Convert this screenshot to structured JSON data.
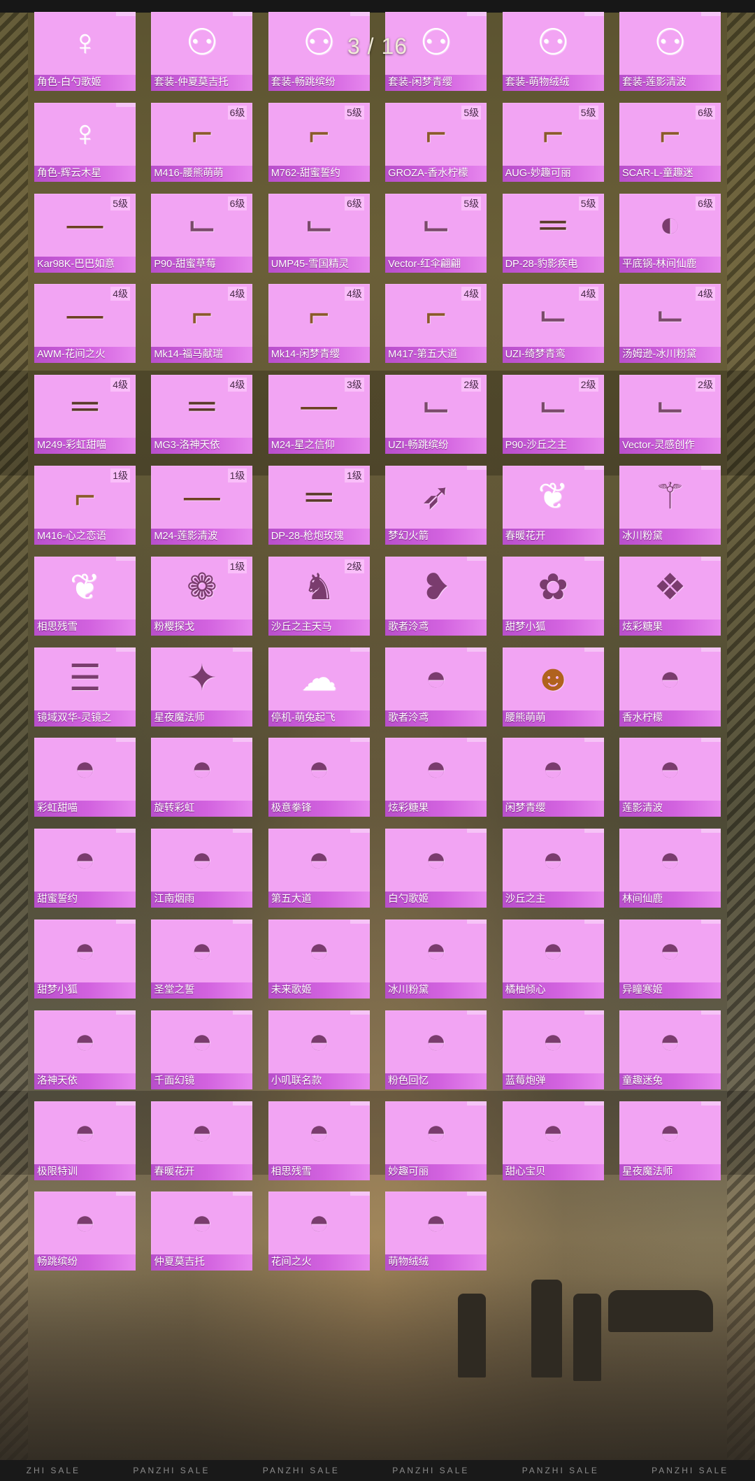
{
  "viewer": {
    "page_counter": "3 / 16"
  },
  "cards": [
    {
      "name": "角色-白勺歌姬",
      "level": "",
      "icon": "character-icon"
    },
    {
      "name": "套装-仲夏莫吉托",
      "level": "",
      "icon": "outfit-icon"
    },
    {
      "name": "套装-畅跳缤纷",
      "level": "",
      "icon": "outfit-icon"
    },
    {
      "name": "套装-闲梦青缨",
      "level": "",
      "icon": "outfit-icon"
    },
    {
      "name": "套装-萌物绒绒",
      "level": "",
      "icon": "outfit-icon"
    },
    {
      "name": "套装-莲影清波",
      "level": "",
      "icon": "outfit-icon"
    },
    {
      "name": "角色-辉云木星",
      "level": "",
      "icon": "character-icon"
    },
    {
      "name": "M416-腰熊萌萌",
      "level": "6级",
      "icon": "rifle-icon"
    },
    {
      "name": "M762-甜蜜誓约",
      "level": "5级",
      "icon": "rifle-icon"
    },
    {
      "name": "GROZA-香水柠檬",
      "level": "5级",
      "icon": "rifle-icon"
    },
    {
      "name": "AUG-妙趣可丽",
      "level": "5级",
      "icon": "rifle-icon"
    },
    {
      "name": "SCAR-L-童趣迷",
      "level": "6级",
      "icon": "rifle-icon"
    },
    {
      "name": "Kar98K-巴巴如意",
      "level": "5级",
      "icon": "sniper-icon"
    },
    {
      "name": "P90-甜蜜草莓",
      "level": "6级",
      "icon": "smg-icon"
    },
    {
      "name": "UMP45-雪国精灵",
      "level": "6级",
      "icon": "smg-icon"
    },
    {
      "name": "Vector-红伞翩翩",
      "level": "5级",
      "icon": "smg-icon"
    },
    {
      "name": "DP-28-豹影疾电",
      "level": "5级",
      "icon": "lmg-icon"
    },
    {
      "name": "平底锅-林间仙鹿",
      "level": "6级",
      "icon": "pan-icon"
    },
    {
      "name": "AWM-花间之火",
      "level": "4级",
      "icon": "sniper-icon"
    },
    {
      "name": "Mk14-福马献瑞",
      "level": "4级",
      "icon": "rifle-icon"
    },
    {
      "name": "Mk14-闲梦青缨",
      "level": "4级",
      "icon": "rifle-icon"
    },
    {
      "name": "M417-第五大道",
      "level": "4级",
      "icon": "rifle-icon"
    },
    {
      "name": "UZI-绮梦青鸾",
      "level": "4级",
      "icon": "smg-icon"
    },
    {
      "name": "汤姆逊-冰川粉黛",
      "level": "4级",
      "icon": "smg-icon"
    },
    {
      "name": "M249-彩虹甜喵",
      "level": "4级",
      "icon": "lmg-icon"
    },
    {
      "name": "MG3-洛神天依",
      "level": "4级",
      "icon": "lmg-icon"
    },
    {
      "name": "M24-星之信仰",
      "level": "3级",
      "icon": "sniper-icon"
    },
    {
      "name": "UZI-畅跳缤纷",
      "level": "2级",
      "icon": "smg-icon"
    },
    {
      "name": "P90-沙丘之主",
      "level": "2级",
      "icon": "smg-icon"
    },
    {
      "name": "Vector-灵感创作",
      "level": "2级",
      "icon": "smg-icon"
    },
    {
      "name": "M416-心之恋语",
      "level": "1级",
      "icon": "rifle-icon"
    },
    {
      "name": "M24-莲影清波",
      "level": "1级",
      "icon": "sniper-icon"
    },
    {
      "name": "DP-28-枪炮玫瑰",
      "level": "1级",
      "icon": "lmg-icon"
    },
    {
      "name": "梦幻火箭",
      "level": "",
      "icon": "glider-icon"
    },
    {
      "name": "春暖花开",
      "level": "",
      "icon": "wings-icon"
    },
    {
      "name": "冰川粉黛",
      "level": "",
      "icon": "wand-icon"
    },
    {
      "name": "相思残雪",
      "level": "",
      "icon": "wings-icon"
    },
    {
      "name": "粉樱探戈",
      "level": "1级",
      "icon": "backpack-icon"
    },
    {
      "name": "沙丘之主天马",
      "level": "2级",
      "icon": "pegasus-icon"
    },
    {
      "name": "歌者泠鸢",
      "level": "",
      "icon": "bird-icon"
    },
    {
      "name": "甜梦小狐",
      "level": "",
      "icon": "fox-icon"
    },
    {
      "name": "炫彩糖果",
      "level": "",
      "icon": "candy-icon"
    },
    {
      "name": "镜域双华-灵镜之",
      "level": "",
      "icon": "feather-icon"
    },
    {
      "name": "星夜魔法师",
      "level": "",
      "icon": "raven-icon"
    },
    {
      "name": "停机-萌兔起飞",
      "level": "",
      "icon": "balloon-icon"
    },
    {
      "name": "歌者泠鸢",
      "level": "",
      "icon": "parachute-icon"
    },
    {
      "name": "腰熊萌萌",
      "level": "",
      "icon": "bear-parachute-icon"
    },
    {
      "name": "香水柠檬",
      "level": "",
      "icon": "parachute-icon"
    },
    {
      "name": "彩虹甜喵",
      "level": "",
      "icon": "parachute-icon"
    },
    {
      "name": "旋转彩虹",
      "level": "",
      "icon": "parachute-icon"
    },
    {
      "name": "极意拳锋",
      "level": "",
      "icon": "parachute-icon"
    },
    {
      "name": "炫彩糖果",
      "level": "",
      "icon": "parachute-icon"
    },
    {
      "name": "闲梦青缨",
      "level": "",
      "icon": "parachute-icon"
    },
    {
      "name": "莲影清波",
      "level": "",
      "icon": "parachute-icon"
    },
    {
      "name": "甜蜜誓约",
      "level": "",
      "icon": "parachute-icon"
    },
    {
      "name": "江南烟雨",
      "level": "",
      "icon": "parachute-icon"
    },
    {
      "name": "第五大道",
      "level": "",
      "icon": "parachute-icon"
    },
    {
      "name": "白勺歌姬",
      "level": "",
      "icon": "parachute-icon"
    },
    {
      "name": "沙丘之主",
      "level": "",
      "icon": "parachute-icon"
    },
    {
      "name": "林间仙鹿",
      "level": "",
      "icon": "parachute-icon"
    },
    {
      "name": "甜梦小狐",
      "level": "",
      "icon": "parachute-icon"
    },
    {
      "name": "圣堂之誓",
      "level": "",
      "icon": "parachute-icon"
    },
    {
      "name": "未来歌姬",
      "level": "",
      "icon": "parachute-icon"
    },
    {
      "name": "冰川粉黛",
      "level": "",
      "icon": "parachute-icon"
    },
    {
      "name": "橘柚倾心",
      "level": "",
      "icon": "parachute-icon"
    },
    {
      "name": "异瞳寒姬",
      "level": "",
      "icon": "parachute-icon"
    },
    {
      "name": "洛神天依",
      "level": "",
      "icon": "parachute-icon"
    },
    {
      "name": "千面幻镜",
      "level": "",
      "icon": "parachute-icon"
    },
    {
      "name": "小叽联名款",
      "level": "",
      "icon": "parachute-icon"
    },
    {
      "name": "粉色回忆",
      "level": "",
      "icon": "parachute-icon"
    },
    {
      "name": "蓝莓炮弹",
      "level": "",
      "icon": "parachute-icon"
    },
    {
      "name": "童趣迷兔",
      "level": "",
      "icon": "parachute-icon"
    },
    {
      "name": "极限特训",
      "level": "",
      "icon": "parachute-icon"
    },
    {
      "name": "春暖花开",
      "level": "",
      "icon": "parachute-icon"
    },
    {
      "name": "相思残雪",
      "level": "",
      "icon": "parachute-icon"
    },
    {
      "name": "妙趣可丽",
      "level": "",
      "icon": "parachute-icon"
    },
    {
      "name": "甜心宝贝",
      "level": "",
      "icon": "parachute-icon"
    },
    {
      "name": "星夜魔法师",
      "level": "",
      "icon": "parachute-icon"
    },
    {
      "name": "畅跳缤纷",
      "level": "",
      "icon": "parachute-icon"
    },
    {
      "name": "仲夏莫吉托",
      "level": "",
      "icon": "parachute-icon"
    },
    {
      "name": "花间之火",
      "level": "",
      "icon": "parachute-icon"
    },
    {
      "name": "萌物绒绒",
      "level": "",
      "icon": "parachute-icon"
    }
  ],
  "footer": {
    "watermarks": [
      "ZHI SALE",
      "PANZHI SALE",
      "PANZHI SALE",
      "PANZHI SALE",
      "PANZHI SALE",
      "PANZHI SALE"
    ]
  },
  "colors": {
    "card_bg": "#f2a4f3",
    "nameplate": "#c555d6",
    "accent": "#e788ee"
  }
}
